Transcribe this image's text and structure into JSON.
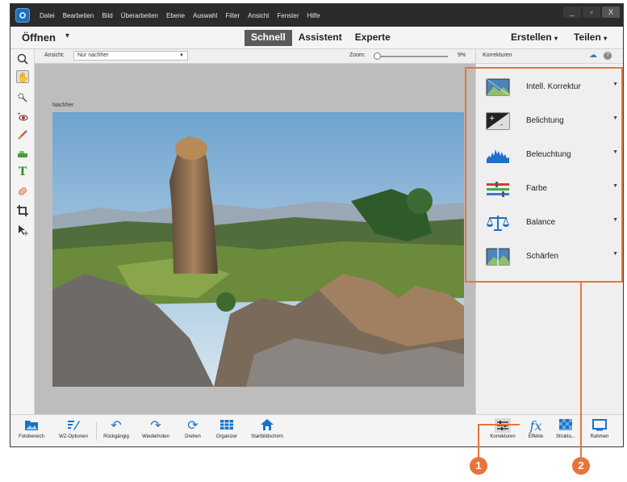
{
  "menubar": [
    "Datei",
    "Bearbeiten",
    "Bild",
    "Überarbeiten",
    "Ebene",
    "Auswahl",
    "Filter",
    "Ansicht",
    "Fenster",
    "Hilfe"
  ],
  "window_controls": {
    "minimize": "_",
    "maximize": "▫",
    "close": "X"
  },
  "topbar": {
    "open_label": "Öffnen",
    "modes": [
      "Schnell",
      "Assistent",
      "Experte"
    ],
    "active_mode": "Schnell",
    "create_label": "Erstellen",
    "share_label": "Teilen"
  },
  "options": {
    "view_label": "Ansicht:",
    "view_value": "Nur nachher",
    "zoom_label": "Zoom:",
    "zoom_value": "9%"
  },
  "document": {
    "label": "Nachher"
  },
  "tools": [
    "zoom-tool",
    "hand-tool",
    "quick-selection-tool",
    "red-eye-tool",
    "whiten-teeth-tool",
    "straighten-tool",
    "type-tool",
    "spot-healing-tool",
    "crop-tool",
    "move-tool"
  ],
  "panel": {
    "title": "Korrekturen",
    "items": [
      {
        "label": "Intell. Korrektur",
        "icon": "smart-fix-icon"
      },
      {
        "label": "Belichtung",
        "icon": "exposure-icon"
      },
      {
        "label": "Beleuchtung",
        "icon": "lighting-icon"
      },
      {
        "label": "Farbe",
        "icon": "color-icon"
      },
      {
        "label": "Balance",
        "icon": "balance-icon"
      },
      {
        "label": "Schärfen",
        "icon": "sharpen-icon"
      }
    ]
  },
  "bottombar": {
    "left": [
      {
        "label": "Fotobereich",
        "icon": "photo-bin-icon"
      },
      {
        "label": "WZ-Optionen",
        "icon": "tool-options-icon"
      },
      {
        "label": "Rückgängig",
        "icon": "undo-icon"
      },
      {
        "label": "Wiederholen",
        "icon": "redo-icon"
      },
      {
        "label": "Drehen",
        "icon": "rotate-icon"
      },
      {
        "label": "Organizer",
        "icon": "organizer-icon"
      },
      {
        "label": "Startbildschirm",
        "icon": "home-icon"
      }
    ],
    "right": [
      {
        "label": "Korrekturen",
        "icon": "adjustments-icon"
      },
      {
        "label": "Effekte",
        "icon": "fx-icon"
      },
      {
        "label": "Struktu...",
        "icon": "textures-icon"
      },
      {
        "label": "Rahmen",
        "icon": "frames-icon"
      }
    ]
  },
  "callouts": [
    "1",
    "2"
  ],
  "accent_color": "#e8743b",
  "link_color": "#1a73c7"
}
